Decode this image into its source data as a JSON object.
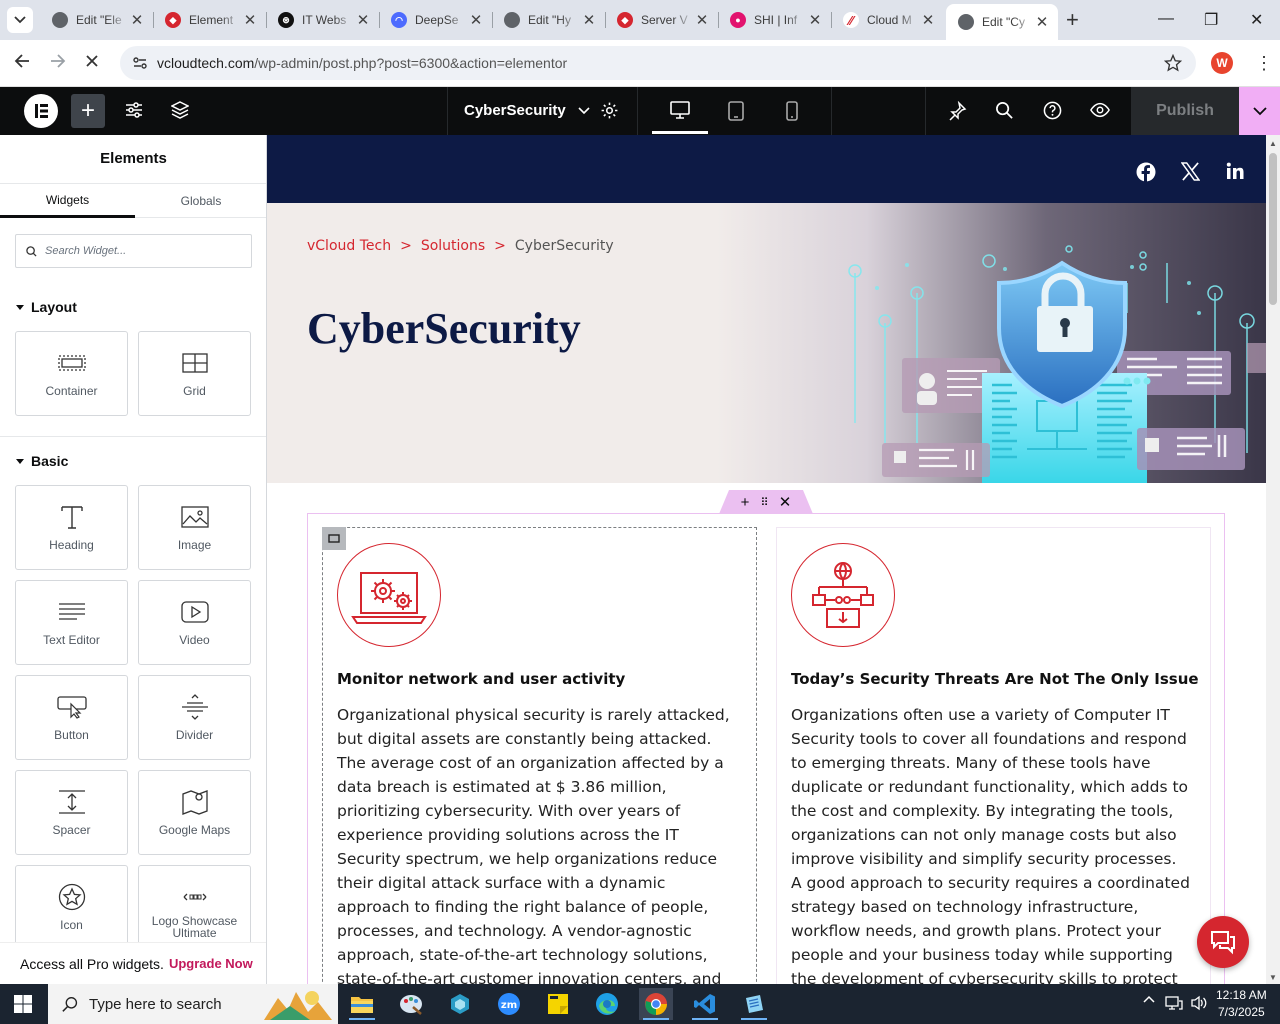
{
  "browser": {
    "tabs": [
      {
        "title": "Edit \"Ele",
        "color": "#5f6368"
      },
      {
        "title": "Element",
        "color": "#d5262f"
      },
      {
        "title": "IT Webs",
        "color": "#111111"
      },
      {
        "title": "DeepSe",
        "color": "#4d6bfe"
      },
      {
        "title": "Edit \"Hy",
        "color": "#5f6368"
      },
      {
        "title": "Server V",
        "color": "#d5262f"
      },
      {
        "title": "SHI | Inf",
        "color": "#e2136e"
      },
      {
        "title": "Cloud M",
        "color": "#d5262f"
      },
      {
        "title": "Edit \"Cy",
        "color": "#5f6368"
      }
    ],
    "url_host": "vcloudtech.com",
    "url_path": "/wp-admin/post.php?post=6300&action=elementor",
    "profile_initial": "W"
  },
  "editor": {
    "page_name": "CyberSecurity",
    "publish_label": "Publish"
  },
  "panel": {
    "title": "Elements",
    "tabs": [
      "Widgets",
      "Globals"
    ],
    "search_placeholder": "Search Widget...",
    "layout_label": "Layout",
    "basic_label": "Basic",
    "layout_widgets": [
      "Container",
      "Grid"
    ],
    "basic_widgets": [
      "Heading",
      "Image",
      "Text Editor",
      "Video",
      "Button",
      "Divider",
      "Spacer",
      "Google Maps",
      "Icon",
      "Logo Showcase Ultimate"
    ],
    "pro_text": "Access all Pro widgets.",
    "pro_link": "Upgrade Now"
  },
  "page": {
    "breadcrumb": [
      "vCloud Tech",
      "Solutions",
      "CyberSecurity"
    ],
    "breadcrumb_sep": ">",
    "hero_title": "CyberSecurity",
    "col1": {
      "heading": "Monitor network and user activity",
      "body": "Organizational physical security is rarely attacked, but digital assets are constantly being attacked. The average cost of an organization affected by a data breach is estimated at $ 3.86 million, prioritizing cybersecurity. With over years of experience providing solutions across the IT Security spectrum, we help organizations reduce their digital attack surface with a dynamic approach to finding the right balance of people, processes, and technology. A vendor-agnostic approach, state-of-the-art technology solutions, state-of-the-art customer innovation centers, and"
    },
    "col2": {
      "heading": "Today’s Security Threats Are Not The Only Issue",
      "body": "Organizations often use a variety of Computer IT Security tools to cover all foundations and respond to emerging threats. Many of these tools have duplicate or redundant functionality, which adds to the cost and complexity. By integrating the tools, organizations can not only manage costs but also improve visibility and simplify security processes. A good approach to security requires a coordinated strategy based on technology infrastructure, workflow needs, and growth plans. Protect your people and your business today while supporting the development of cybersecurity skills to protect"
    }
  },
  "taskbar": {
    "search_placeholder": "Type here to search",
    "time": "12:18 AM",
    "date": "7/3/2025"
  },
  "colors": {
    "brand_red": "#d5262f",
    "navy": "#0d1a45",
    "elementor_pink": "#f1aef5"
  }
}
